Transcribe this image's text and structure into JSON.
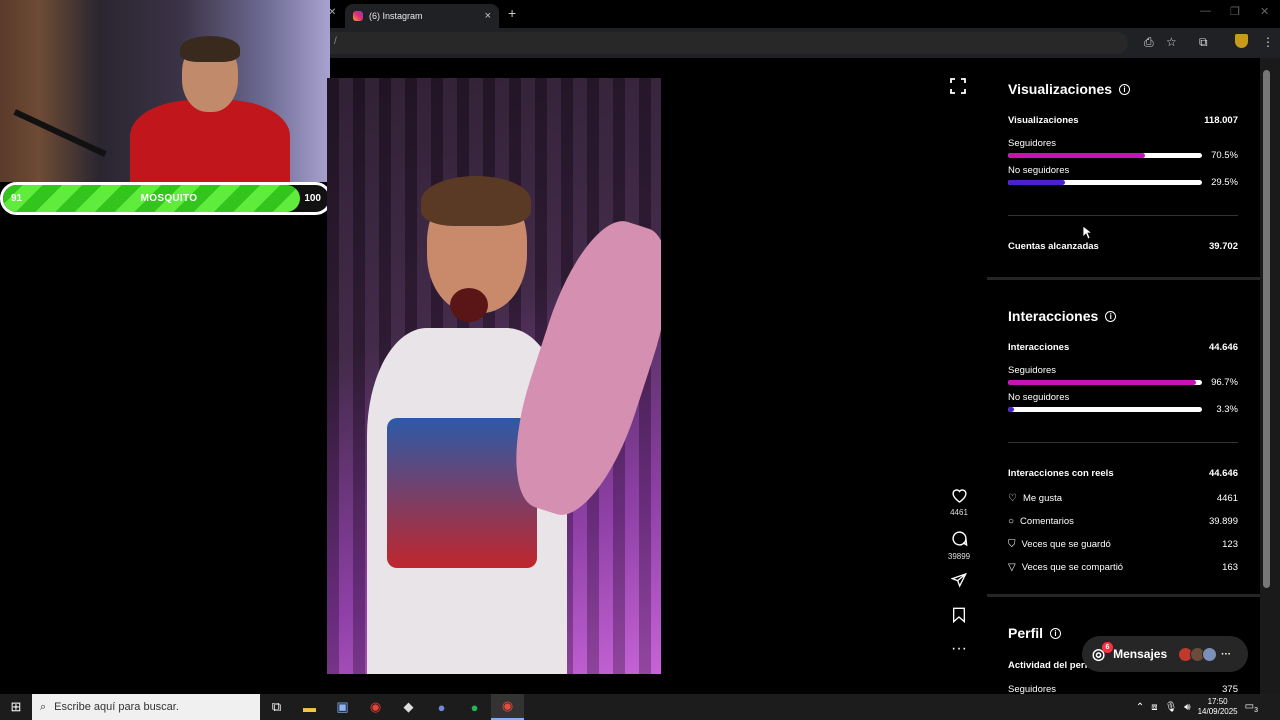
{
  "browser": {
    "tab_title": "(6) Instagram",
    "new_tab": "+",
    "close": "×",
    "omnibox_text": "/"
  },
  "overlay": {
    "hp_left": "91",
    "hp_name": "MOSQUITO",
    "hp_right": "100",
    "hp_fraction": 0.91
  },
  "reel_actions": {
    "likes": "4461",
    "comments": "39899"
  },
  "insights": {
    "views": {
      "title": "Visualizaciones",
      "total_label": "Visualizaciones",
      "total_value": "118.007",
      "followers_label": "Seguidores",
      "followers_pct": "70.5%",
      "followers_fraction": 0.705,
      "nonfollowers_label": "No seguidores",
      "nonfollowers_pct": "29.5%",
      "nonfollowers_fraction": 0.295,
      "reach_label": "Cuentas alcanzadas",
      "reach_value": "39.702"
    },
    "interactions": {
      "title": "Interacciones",
      "total_label": "Interacciones",
      "total_value": "44.646",
      "followers_label": "Seguidores",
      "followers_pct": "96.7%",
      "followers_fraction": 0.967,
      "nonfollowers_label": "No seguidores",
      "nonfollowers_pct": "3.3%",
      "nonfollowers_fraction": 0.033,
      "reels_label": "Interacciones con reels",
      "reels_value": "44.646",
      "likes_label": "Me gusta",
      "likes_value": "4461",
      "comments_label": "Comentarios",
      "comments_value": "39.899",
      "saves_label": "Veces que se guardó",
      "saves_value": "123",
      "shares_label": "Veces que se compartió",
      "shares_value": "163"
    },
    "profile": {
      "title": "Perfil",
      "activity_label": "Actividad del perfil",
      "followers_label": "Seguidores",
      "followers_value": "375"
    }
  },
  "messages": {
    "label": "Mensajes",
    "badge": "6"
  },
  "taskbar": {
    "search_placeholder": "Escribe aquí para buscar.",
    "time": "17:50",
    "date": "14/09/2025",
    "notif_count": "3"
  },
  "colors": {
    "follower_bar": "#c812b4",
    "nonfollower_bar": "#4c1fd1",
    "hp_green": "#44d62c"
  }
}
